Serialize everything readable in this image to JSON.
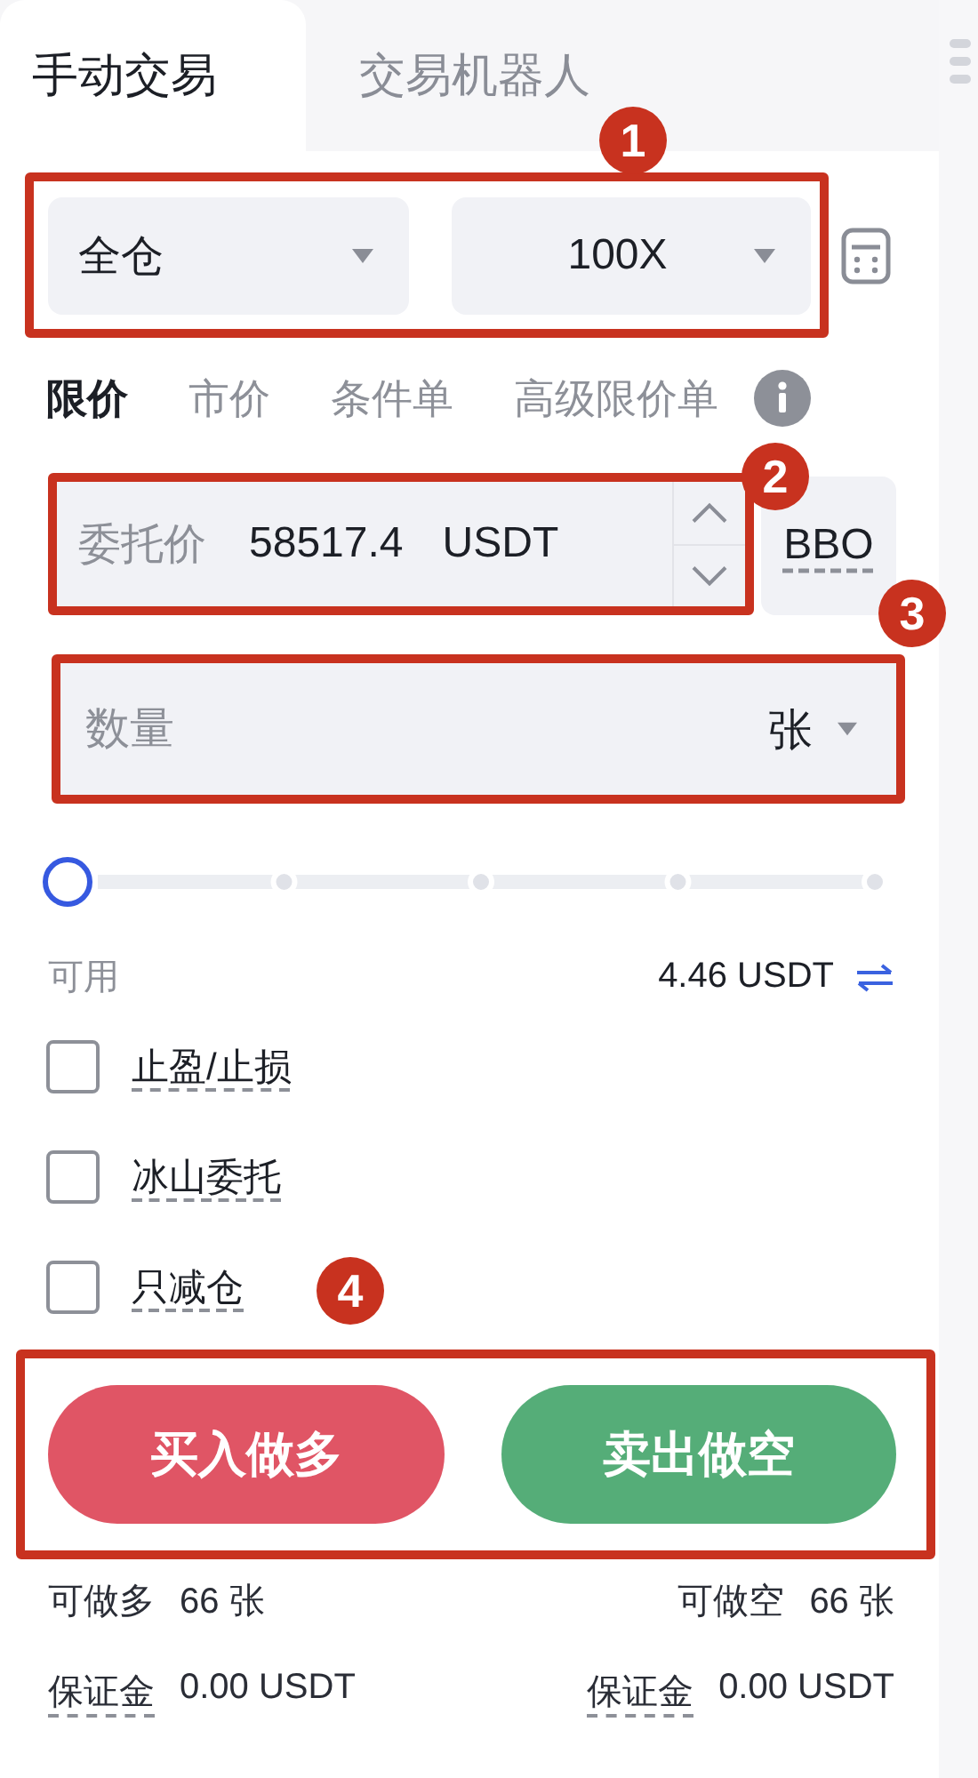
{
  "tabs": [
    {
      "label": "手动交易",
      "selected": true
    },
    {
      "label": "交易机器人",
      "selected": false
    }
  ],
  "margin_mode": {
    "value": "全仓"
  },
  "leverage": {
    "value": "100X"
  },
  "order_types": [
    {
      "label": "限价",
      "selected": true
    },
    {
      "label": "市价",
      "selected": false
    },
    {
      "label": "条件单",
      "selected": false
    },
    {
      "label": "高级限价单",
      "selected": false
    }
  ],
  "price_field": {
    "label": "委托价",
    "value": "58517.4",
    "unit": "USDT"
  },
  "bbo_button": "BBO",
  "quantity_field": {
    "placeholder": "数量",
    "unit": "张"
  },
  "slider": {
    "level": 0
  },
  "available": {
    "label": "可用",
    "value": "4.46 USDT"
  },
  "options": [
    {
      "label": "止盈/止损",
      "checked": false
    },
    {
      "label": "冰山委托",
      "checked": false
    },
    {
      "label": "只减仓",
      "checked": false
    }
  ],
  "buttons": [
    {
      "kind": "buy",
      "label": "买入做多"
    },
    {
      "kind": "sell",
      "label": "卖出做空"
    }
  ],
  "capacity": [
    {
      "label": "可做多",
      "value": "66 张"
    },
    {
      "label": "可做空",
      "value": "66 张"
    }
  ],
  "margin": [
    {
      "label": "保证金",
      "value": "0.00 USDT"
    },
    {
      "label": "保证金",
      "value": "0.00 USDT"
    }
  ],
  "annotations": [
    "1",
    "2",
    "3",
    "4"
  ]
}
